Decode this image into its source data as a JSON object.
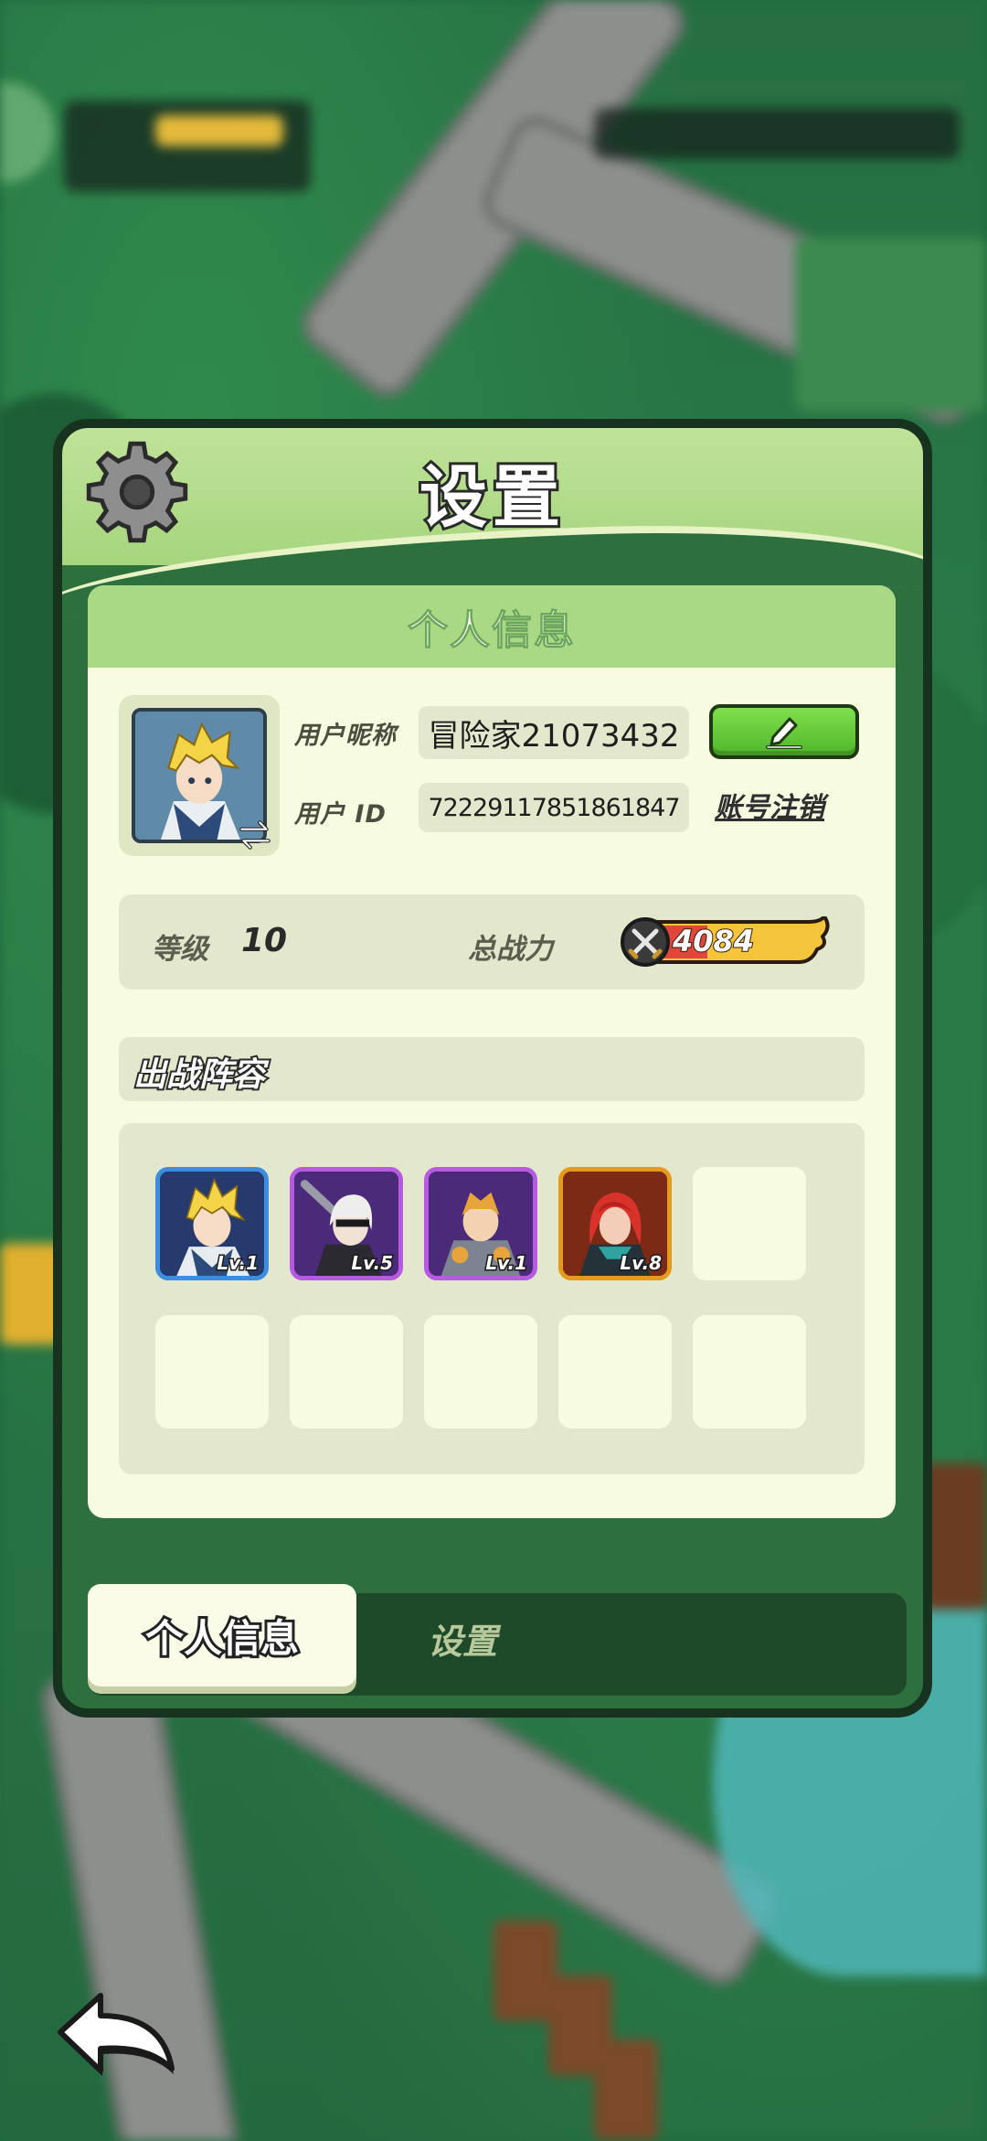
{
  "panel": {
    "title": "设置"
  },
  "profile_card": {
    "title": "个人信息",
    "nickname_label": "用户昵称",
    "nickname_value": "冒险家21073432",
    "uid_label": "用户 ID",
    "uid_value": "72229117851861847",
    "cancel_account": "账号注销",
    "edit_icon": "pencil-icon",
    "avatar_icon": "hero-portrait",
    "swap_icon": "swap-arrows-icon"
  },
  "stats": {
    "level_label": "等级",
    "level_value": "10",
    "power_label": "总战力",
    "power_value": "4084",
    "power_icon": "crossed-swords-icon"
  },
  "lineup": {
    "title": "出战阵容",
    "heroes": [
      {
        "level": "Lv.1",
        "rarity": "rare",
        "accent": "#f3d04a"
      },
      {
        "level": "Lv.5",
        "rarity": "epic",
        "accent": "#e8e8e8"
      },
      {
        "level": "Lv.1",
        "rarity": "epic",
        "accent": "#e6a43a"
      },
      {
        "level": "Lv.8",
        "rarity": "legend",
        "accent": "#d8322a"
      }
    ],
    "empty_slots": 6
  },
  "tabs": {
    "active": "个人信息",
    "inactive": "设置"
  },
  "colors": {
    "header_green": "#a6d57e",
    "card_bg": "#f7fbe0",
    "edit_green": "#5cc432",
    "power_gold": "#f4c43a"
  }
}
